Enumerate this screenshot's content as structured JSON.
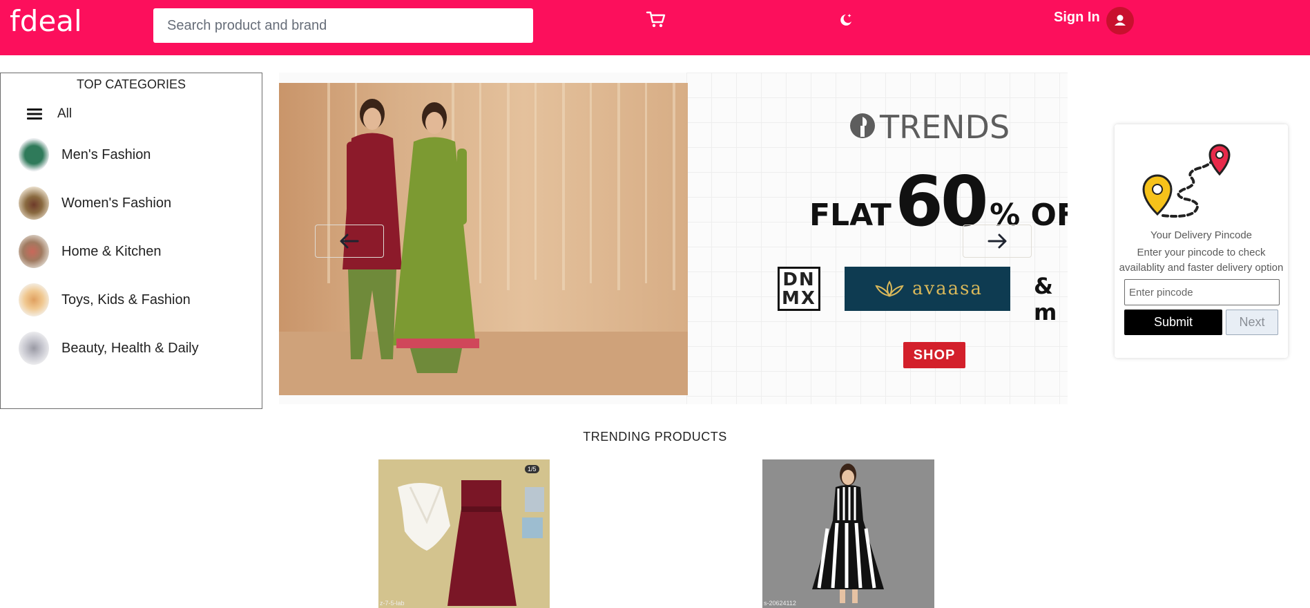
{
  "header": {
    "logo": "fdeal",
    "search_placeholder": "Search product and brand",
    "cart_icon": "cart-icon",
    "theme_icon": "moon-icon",
    "signin_label": "Sign In",
    "avatar_icon": "user-icon",
    "brand_color": "#fc0f5c"
  },
  "sidebar": {
    "title": "TOP CATEGORIES",
    "all_label": "All",
    "items": [
      {
        "label": "Men's Fashion",
        "thumb": "#2f7a5a"
      },
      {
        "label": "Women's Fashion",
        "thumb": "#8a6a40"
      },
      {
        "label": "Home & Kitchen",
        "thumb": "#a07a60"
      },
      {
        "label": "Toys, Kids & Fashion",
        "thumb": "#e0a060"
      },
      {
        "label": "Beauty, Health & Daily",
        "thumb": "#b0b0b8"
      }
    ]
  },
  "banner": {
    "brand": "TRENDS",
    "offer_flat": "FLAT",
    "offer_value": "60",
    "offer_suffix": "% OFF*",
    "dnmx_line1": "DN",
    "dnmx_line2": "MX",
    "avaasa": "avaasa",
    "amp": "& m",
    "shop_label": "SHOP"
  },
  "pincode": {
    "title": "Your Delivery Pincode",
    "description": "Enter your pincode to check availablity and faster delivery option",
    "input_placeholder": "Enter pincode",
    "submit_label": "Submit",
    "next_label": "Next"
  },
  "trending": {
    "title": "TRENDING PRODUCTS",
    "products": [
      {
        "badge": "1/5",
        "sku": "z-7-5-lab"
      },
      {
        "sku": "s-20624112"
      }
    ]
  }
}
